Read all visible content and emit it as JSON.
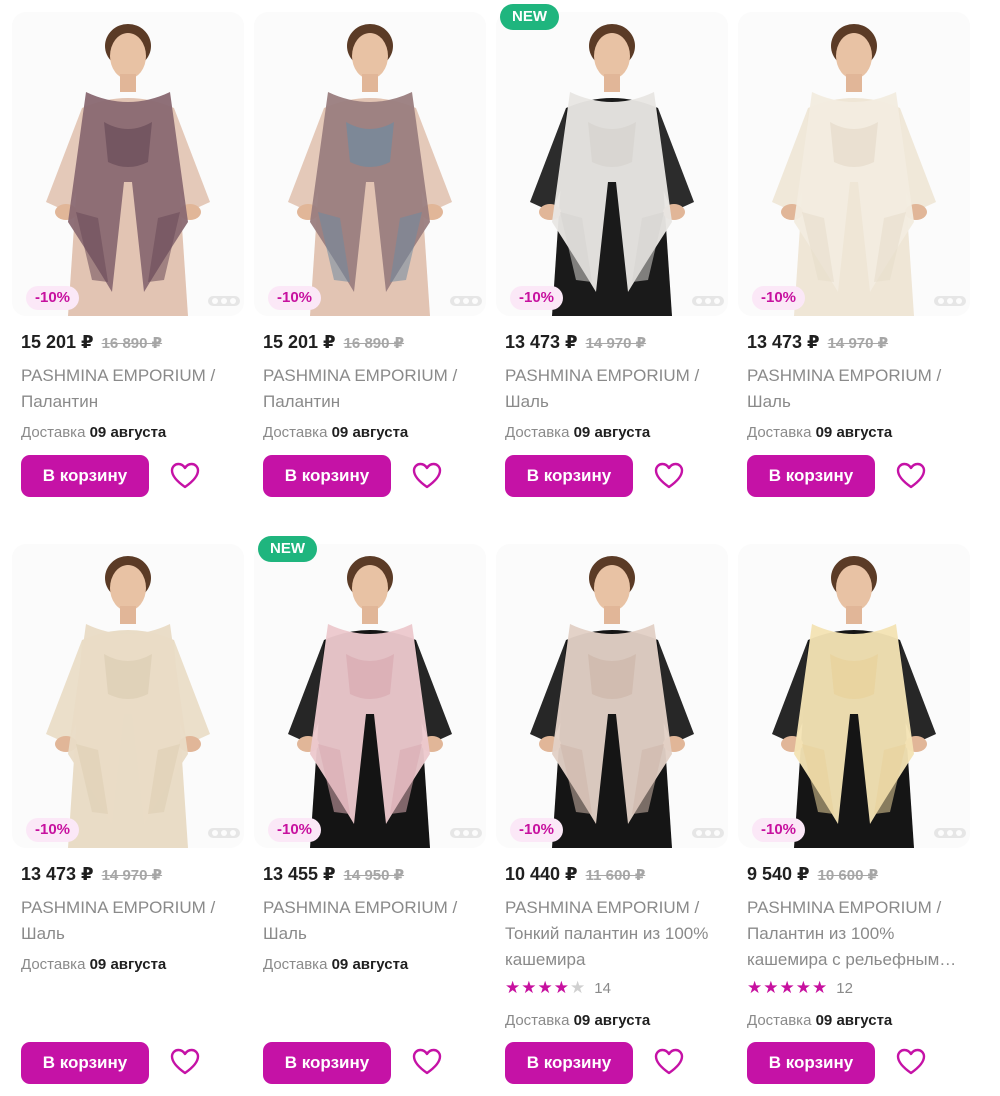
{
  "products": [
    {
      "badge_new": "",
      "discount": "-10%",
      "price": "15 201 ₽",
      "old_price": "16 890 ₽",
      "brand": "PASHMINA EMPORIUM /",
      "name": "Палантин",
      "delivery_label": "Доставка",
      "delivery_date": "09 августа",
      "cart_label": "В корзину",
      "scarf_color": "#8a6a72",
      "scarf_accent": "#6a4b58",
      "outfit_color": "#e2c4b3"
    },
    {
      "badge_new": "",
      "discount": "-10%",
      "price": "15 201 ₽",
      "old_price": "16 890 ₽",
      "brand": "PASHMINA EMPORIUM /",
      "name": "Палантин",
      "delivery_label": "Доставка",
      "delivery_date": "09 августа",
      "cart_label": "В корзину",
      "scarf_color": "#9b7f80",
      "scarf_accent": "#6f8aa0",
      "outfit_color": "#e2c4b3"
    },
    {
      "badge_new": "NEW",
      "discount": "-10%",
      "price": "13 473 ₽",
      "old_price": "14 970 ₽",
      "brand": "PASHMINA EMPORIUM /",
      "name": "Шаль",
      "delivery_label": "Доставка",
      "delivery_date": "09 августа",
      "cart_label": "В корзину",
      "scarf_color": "#e8e6e3",
      "scarf_accent": "#d6d3cf",
      "outfit_color": "#1a1a1a"
    },
    {
      "badge_new": "",
      "discount": "-10%",
      "price": "13 473 ₽",
      "old_price": "14 970 ₽",
      "brand": "PASHMINA EMPORIUM /",
      "name": "Шаль",
      "delivery_label": "Доставка",
      "delivery_date": "09 августа",
      "cart_label": "В корзину",
      "scarf_color": "#f3ece0",
      "scarf_accent": "#e6dccb",
      "outfit_color": "#efe6d6"
    },
    {
      "badge_new": "",
      "discount": "-10%",
      "price": "13 473 ₽",
      "old_price": "14 970 ₽",
      "brand": "PASHMINA EMPORIUM /",
      "name": "Шаль",
      "delivery_label": "Доставка",
      "delivery_date": "09 августа",
      "cart_label": "В корзину",
      "scarf_color": "#e9dcc6",
      "scarf_accent": "#dccdb3",
      "outfit_color": "#e9dcc6"
    },
    {
      "badge_new": "NEW",
      "discount": "-10%",
      "price": "13 455 ₽",
      "old_price": "14 950 ₽",
      "brand": "PASHMINA EMPORIUM /",
      "name": "Шаль",
      "delivery_label": "Доставка",
      "delivery_date": "09 августа",
      "cart_label": "В корзину",
      "scarf_color": "#ecc9cd",
      "scarf_accent": "#d9a9b0",
      "outfit_color": "#141414"
    },
    {
      "badge_new": "",
      "discount": "-10%",
      "price": "10 440 ₽",
      "old_price": "11 600 ₽",
      "brand": "PASHMINA EMPORIUM /",
      "name": "Тонкий палантин из 100% кашемира",
      "rating_stars": 4,
      "rating_count": "14",
      "delivery_label": "Доставка",
      "delivery_date": "09 августа",
      "cart_label": "В корзину",
      "scarf_color": "#e2d0c6",
      "scarf_accent": "#cdb6aa",
      "outfit_color": "#151515"
    },
    {
      "badge_new": "",
      "discount": "-10%",
      "price": "9 540 ₽",
      "old_price": "10 600 ₽",
      "brand": "PASHMINA EMPORIUM /",
      "name": "Палантин из 100% кашемира с рельефным…",
      "rating_stars": 5,
      "rating_count": "12",
      "delivery_label": "Доставка",
      "delivery_date": "09 августа",
      "cart_label": "В корзину",
      "scarf_color": "#f4e3b4",
      "scarf_accent": "#e8d29a",
      "outfit_color": "#151515"
    }
  ],
  "colors": {
    "accent": "#c512a6",
    "new_badge": "#1fb57e",
    "discount_bg": "#fbe8f7",
    "discount_text": "#c7119f",
    "muted_text": "#8a8a8a",
    "old_price": "#a6a6a6"
  },
  "icons": {
    "favorite": "heart-outline-icon",
    "rating": "star-icon"
  }
}
